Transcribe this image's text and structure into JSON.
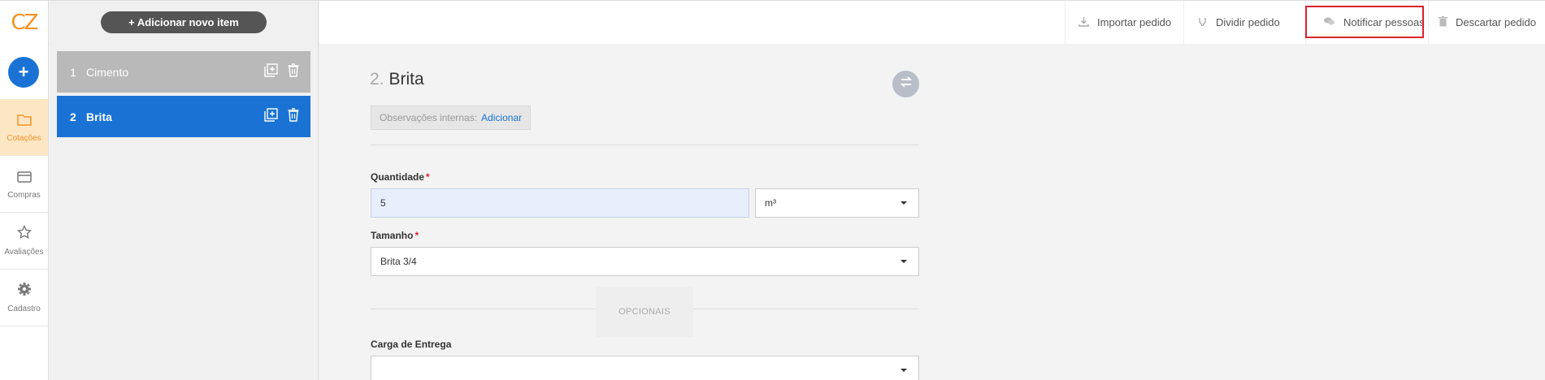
{
  "logo": {
    "text": "CZ"
  },
  "items_panel": {
    "add_button_label": "+ Adicionar novo item",
    "items": [
      {
        "num": "1",
        "name": "Cimento",
        "state": "inactive"
      },
      {
        "num": "2",
        "name": "Brita",
        "state": "selected"
      }
    ]
  },
  "toolbar": {
    "import_label": "Importar pedido",
    "split_label": "Dividir pedido",
    "notify_label": "Notificar pessoas",
    "discard_label": "Descartar pedido"
  },
  "leftnav": {
    "add_label": "+",
    "items": [
      {
        "label": "Cotações",
        "icon": "folder-icon",
        "active": true
      },
      {
        "label": "Compras",
        "icon": "card-icon",
        "active": false
      },
      {
        "label": "Avaliações",
        "icon": "star-icon",
        "active": false
      },
      {
        "label": "Cadastro",
        "icon": "gear-icon",
        "active": false
      }
    ]
  },
  "main": {
    "item_number": "2.",
    "item_title": "Brita",
    "obs_label": "Observações internas:",
    "obs_link": "Adicionar",
    "quantity_label": "Quantidade",
    "required_mark": "*",
    "quantity_value": "5",
    "unit_value": "m³",
    "size_label": "Tamanho",
    "size_value": "Brita 3/4",
    "optional_label": "OPCIONAIS",
    "delivery_label": "Carga de Entrega",
    "delivery_value": ""
  },
  "colors": {
    "accent": "#f39224",
    "primary": "#1a73d4",
    "highlight": "#d9232d"
  }
}
